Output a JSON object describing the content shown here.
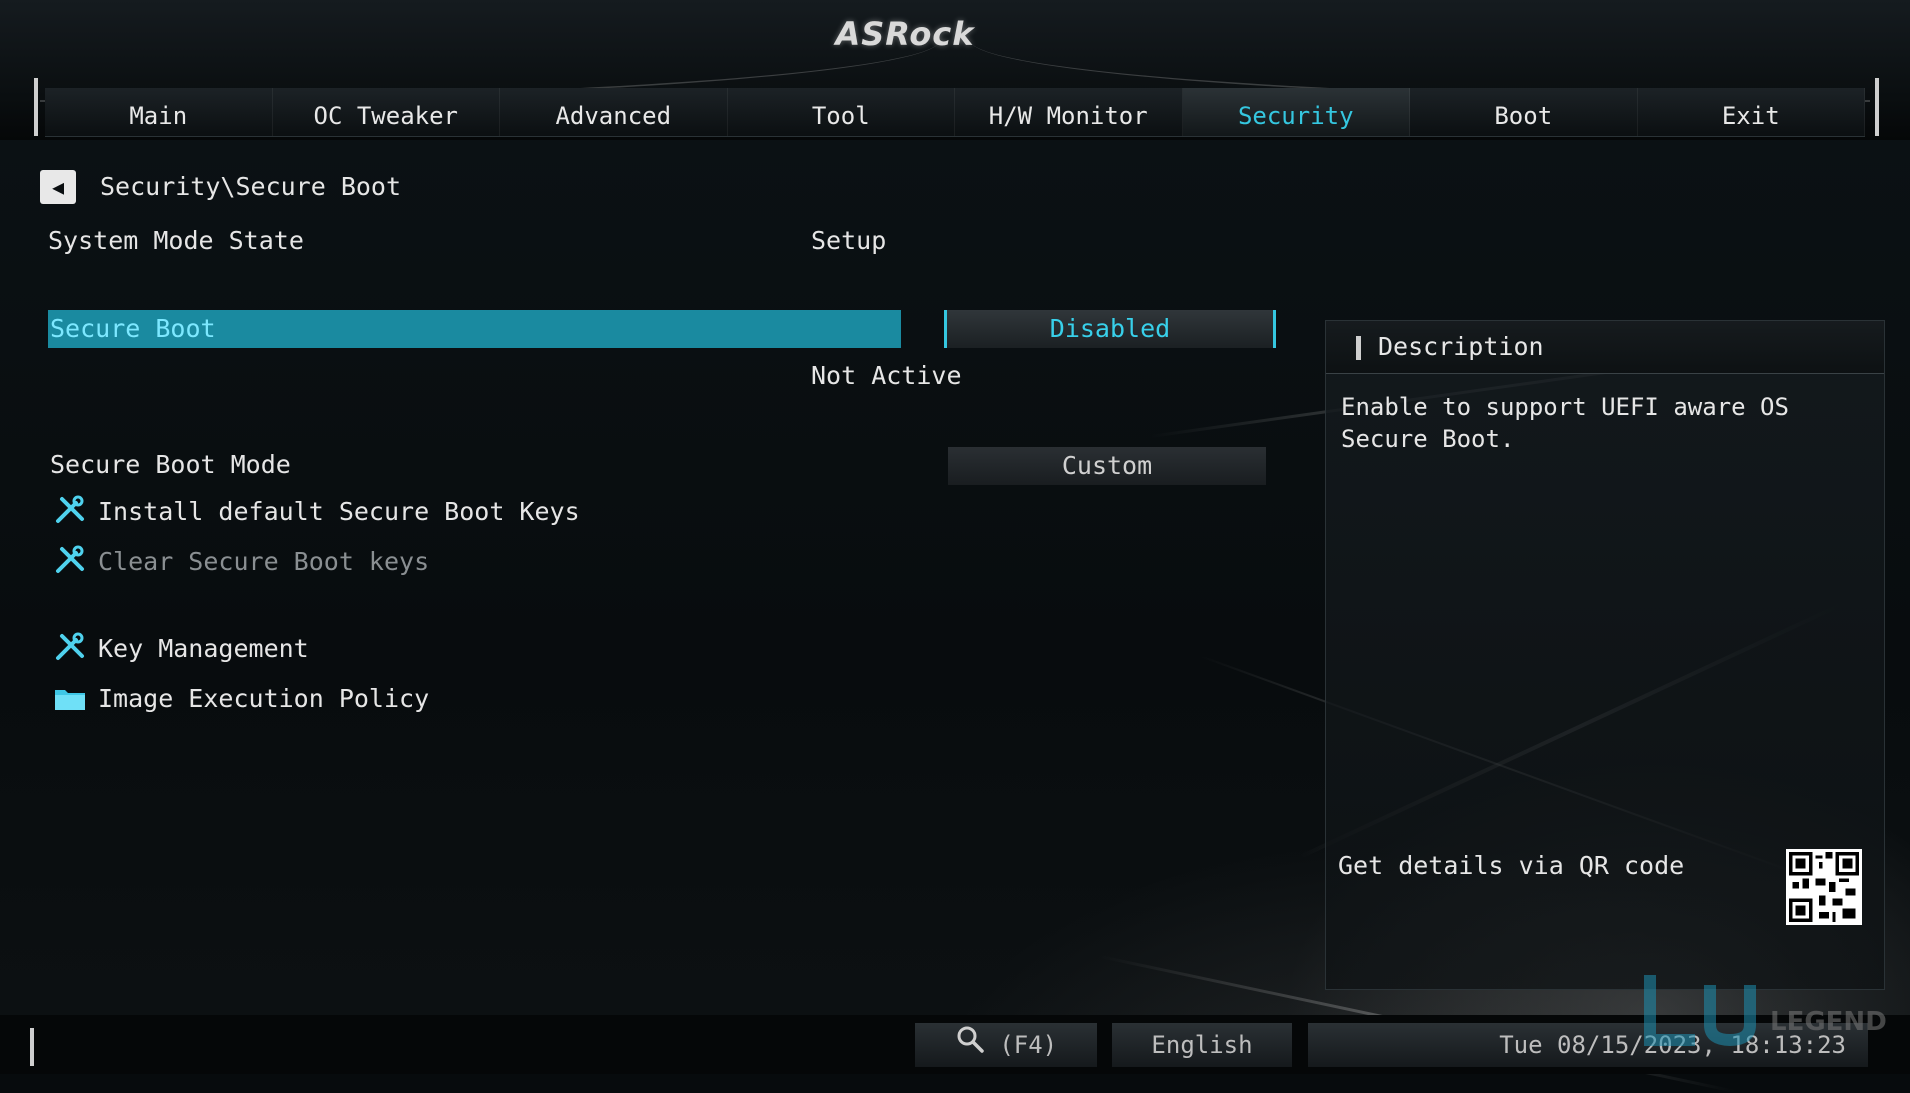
{
  "brand": "ASRock",
  "tabs": [
    {
      "label": "Main"
    },
    {
      "label": "OC Tweaker"
    },
    {
      "label": "Advanced"
    },
    {
      "label": "Tool"
    },
    {
      "label": "H/W Monitor"
    },
    {
      "label": "Security"
    },
    {
      "label": "Boot"
    },
    {
      "label": "Exit"
    }
  ],
  "active_tab": "Security",
  "breadcrumb": "Security\\Secure Boot",
  "system_mode": {
    "label": "System Mode State",
    "value": "Setup"
  },
  "secure_boot": {
    "label": "Secure Boot",
    "value": "Disabled",
    "status": "Not Active"
  },
  "secure_boot_mode": {
    "label": "Secure Boot Mode",
    "value": "Custom"
  },
  "menu_items": [
    {
      "label": "Install default Secure Boot Keys",
      "icon": "wrench-tool-icon"
    },
    {
      "label": "Clear Secure Boot keys",
      "icon": "wrench-tool-icon"
    },
    {
      "label": "Key Management",
      "icon": "wrench-tool-icon"
    },
    {
      "label": "Image Execution Policy",
      "icon": "folder-icon"
    }
  ],
  "description": {
    "title": "Description",
    "text": "Enable to support UEFI aware OS Secure Boot.",
    "qr_label": "Get details via QR code"
  },
  "footer": {
    "search": "(F4)",
    "language": "English",
    "datetime": "Tue 08/15/2023, 18:13:23"
  },
  "colors": {
    "accent": "#35c7e0",
    "selection": "#1a8aa0"
  }
}
